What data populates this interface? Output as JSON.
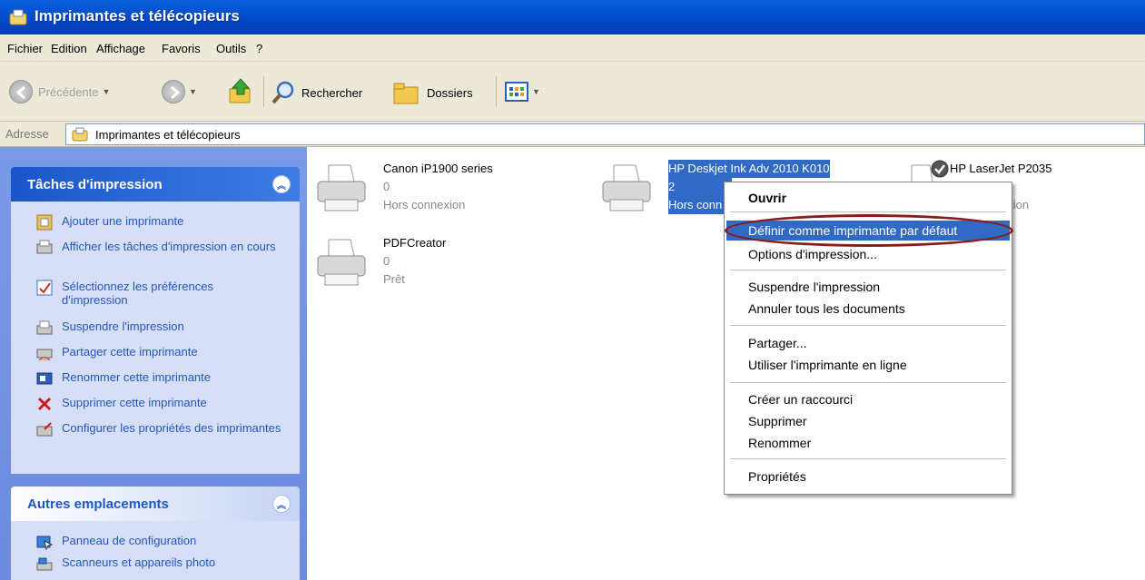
{
  "window": {
    "title": "Imprimantes et télécopieurs"
  },
  "menubar": [
    "Fichier",
    "Edition",
    "Affichage",
    "Favoris",
    "Outils",
    "?"
  ],
  "toolbar": {
    "back": "Précédente",
    "search": "Rechercher",
    "folders": "Dossiers"
  },
  "address": {
    "label": "Adresse",
    "value": "Imprimantes et télécopieurs"
  },
  "sidebar": {
    "print_tasks": {
      "title": "Tâches d'impression",
      "items": [
        {
          "label": "Ajouter une imprimante",
          "icon": "add-printer-icon"
        },
        {
          "label": "Afficher les tâches d'impression en cours",
          "icon": "print-queue-icon"
        },
        {
          "label": "Sélectionnez les préférences d'impression",
          "icon": "preferences-icon"
        },
        {
          "label": "Suspendre l'impression",
          "icon": "pause-printer-icon"
        },
        {
          "label": "Partager cette imprimante",
          "icon": "share-printer-icon"
        },
        {
          "label": "Renommer cette imprimante",
          "icon": "rename-icon"
        },
        {
          "label": "Supprimer cette imprimante",
          "icon": "delete-icon"
        },
        {
          "label": "Configurer les propriétés des imprimantes",
          "icon": "printer-properties-icon"
        }
      ]
    },
    "other_places": {
      "title": "Autres emplacements",
      "items": [
        {
          "label": "Panneau de configuration",
          "icon": "control-panel-icon"
        },
        {
          "label": "Scanneurs et appareils photo",
          "icon": "scanner-camera-icon"
        }
      ]
    }
  },
  "printers": [
    {
      "name": "Canon iP1900 series",
      "docs": "0",
      "status": "Hors connexion"
    },
    {
      "name": "HP Deskjet Ink Adv 2010 K010",
      "docs": "2",
      "status": "Hors conn"
    },
    {
      "name": "HP LaserJet P2035",
      "docs": "",
      "status": "exion",
      "default": true
    },
    {
      "name": "PDFCreator",
      "docs": "0",
      "status": "Prêt"
    }
  ],
  "context_menu": {
    "items": [
      "Ouvrir",
      "Définir comme imprimante par défaut",
      "Options d'impression...",
      "Suspendre l'impression",
      "Annuler tous les documents",
      "Partager...",
      "Utiliser l'imprimante en ligne",
      "Créer un raccourci",
      "Supprimer",
      "Renommer",
      "Propriétés"
    ],
    "highlighted_index": 1
  },
  "colors": {
    "title_bar": "#0a5fdc",
    "selection": "#316ac5",
    "task_link": "#2157c2",
    "highlight_ring": "#8b1a1a"
  }
}
